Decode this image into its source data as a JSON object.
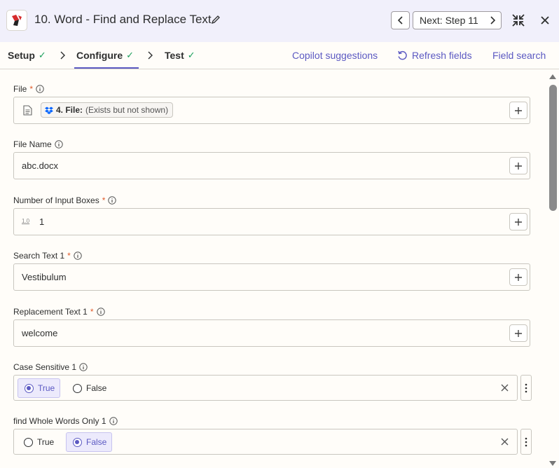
{
  "header": {
    "title": "10. Word - Find and Replace Text",
    "next_label": "Next: Step 11"
  },
  "tabs": {
    "setup": "Setup",
    "configure": "Configure",
    "test": "Test",
    "copilot": "Copilot suggestions",
    "refresh": "Refresh fields",
    "field_search": "Field search"
  },
  "fields": {
    "file": {
      "label": "File",
      "pill_bold": "4. File:",
      "pill_text": "(Exists but not shown)"
    },
    "file_name": {
      "label": "File Name",
      "value": "abc.docx"
    },
    "num_boxes": {
      "label": "Number of Input Boxes",
      "icon_text": "1.0",
      "value": "1"
    },
    "search_text": {
      "label": "Search Text 1",
      "value": "Vestibulum"
    },
    "replacement_text": {
      "label": "Replacement Text 1",
      "value": "welcome"
    },
    "case_sensitive": {
      "label": "Case Sensitive 1",
      "true_label": "True",
      "false_label": "False",
      "selected": "True"
    },
    "whole_words": {
      "label": "find Whole Words Only 1",
      "true_label": "True",
      "false_label": "False",
      "selected": "False"
    }
  },
  "colors": {
    "accent": "#5b59c2",
    "required": "#e05b2b",
    "check": "#1a9e5a"
  }
}
